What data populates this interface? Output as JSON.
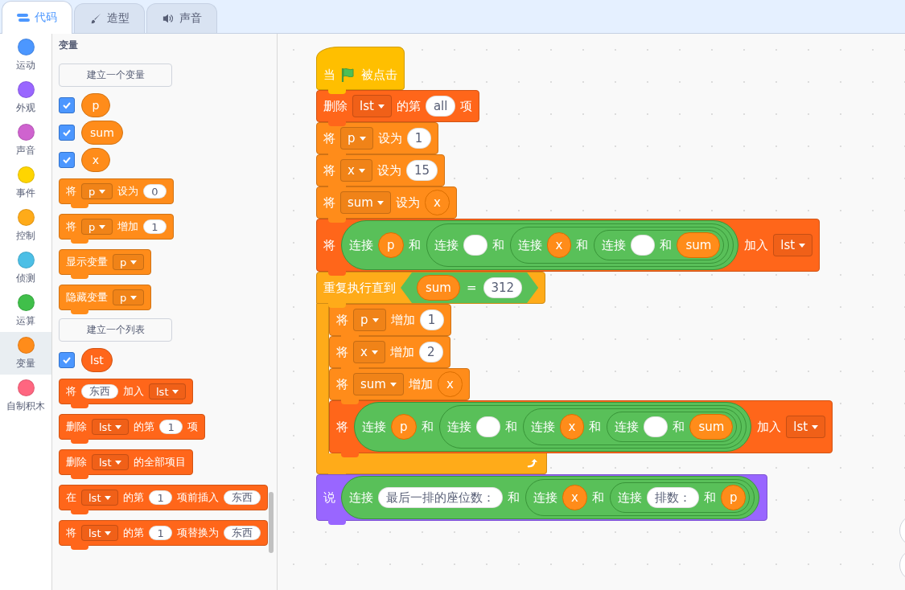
{
  "tabs": [
    {
      "label": "代码",
      "selected": true
    },
    {
      "label": "造型",
      "selected": false
    },
    {
      "label": "声音",
      "selected": false
    }
  ],
  "categories": [
    {
      "label": "运动",
      "color": "#4c97ff",
      "selected": false
    },
    {
      "label": "外观",
      "color": "#9966ff",
      "selected": false
    },
    {
      "label": "声音",
      "color": "#cf63cf",
      "selected": false
    },
    {
      "label": "事件",
      "color": "#ffd500",
      "selected": false
    },
    {
      "label": "控制",
      "color": "#ffab19",
      "selected": false
    },
    {
      "label": "侦测",
      "color": "#4cbfe6",
      "selected": false
    },
    {
      "label": "运算",
      "color": "#40bf4a",
      "selected": false
    },
    {
      "label": "变量",
      "color": "#ff8c1a",
      "selected": true
    },
    {
      "label": "自制积木",
      "color": "#ff6680",
      "selected": false
    }
  ],
  "palette": [
    {
      "kind": "heading",
      "text": "变量"
    },
    {
      "kind": "button",
      "text": "建立一个变量"
    },
    {
      "kind": "variable",
      "name": "p",
      "checked": true,
      "color": "#ff8c1a"
    },
    {
      "kind": "variable",
      "name": "sum",
      "checked": true,
      "color": "#ff8c1a"
    },
    {
      "kind": "variable",
      "name": "x",
      "checked": true,
      "color": "#ff8c1a"
    },
    {
      "kind": "block",
      "color": "#ff8c1a",
      "parts": [
        {
          "kind": "label",
          "text": "将"
        },
        {
          "kind": "dropdown",
          "text": "p"
        },
        {
          "kind": "label",
          "text": "设为"
        },
        {
          "kind": "input",
          "text": "0"
        }
      ]
    },
    {
      "kind": "block",
      "color": "#ff8c1a",
      "parts": [
        {
          "kind": "label",
          "text": "将"
        },
        {
          "kind": "dropdown",
          "text": "p"
        },
        {
          "kind": "label",
          "text": "增加"
        },
        {
          "kind": "input",
          "text": "1"
        }
      ]
    },
    {
      "kind": "block",
      "color": "#ff8c1a",
      "parts": [
        {
          "kind": "label",
          "text": "显示变量"
        },
        {
          "kind": "dropdown",
          "text": "p"
        }
      ]
    },
    {
      "kind": "block",
      "color": "#ff8c1a",
      "parts": [
        {
          "kind": "label",
          "text": "隐藏变量"
        },
        {
          "kind": "dropdown",
          "text": "p"
        }
      ]
    },
    {
      "kind": "button",
      "text": "建立一个列表"
    },
    {
      "kind": "variable",
      "name": "lst",
      "checked": true,
      "color": "#ff661a"
    },
    {
      "kind": "block",
      "color": "#ff661a",
      "parts": [
        {
          "kind": "label",
          "text": "将"
        },
        {
          "kind": "input",
          "text": "东西"
        },
        {
          "kind": "label",
          "text": "加入"
        },
        {
          "kind": "dropdown",
          "text": "lst"
        }
      ]
    },
    {
      "kind": "block",
      "color": "#ff661a",
      "parts": [
        {
          "kind": "label",
          "text": "删除"
        },
        {
          "kind": "dropdown",
          "text": "lst"
        },
        {
          "kind": "label",
          "text": "的第"
        },
        {
          "kind": "input",
          "text": "1"
        },
        {
          "kind": "label",
          "text": "项"
        }
      ]
    },
    {
      "kind": "block",
      "color": "#ff661a",
      "parts": [
        {
          "kind": "label",
          "text": "删除"
        },
        {
          "kind": "dropdown",
          "text": "lst"
        },
        {
          "kind": "label",
          "text": "的全部项目"
        }
      ]
    },
    {
      "kind": "block",
      "color": "#ff661a",
      "parts": [
        {
          "kind": "label",
          "text": "在"
        },
        {
          "kind": "dropdown",
          "text": "lst"
        },
        {
          "kind": "label",
          "text": "的第"
        },
        {
          "kind": "input",
          "text": "1"
        },
        {
          "kind": "label",
          "text": "项前插入"
        },
        {
          "kind": "input",
          "text": "东西"
        }
      ]
    },
    {
      "kind": "block",
      "color": "#ff661a",
      "parts": [
        {
          "kind": "label",
          "text": "将"
        },
        {
          "kind": "dropdown",
          "text": "lst"
        },
        {
          "kind": "label",
          "text": "的第"
        },
        {
          "kind": "input",
          "text": "1"
        },
        {
          "kind": "label",
          "text": "项替换为"
        },
        {
          "kind": "input",
          "text": "东西"
        }
      ]
    }
  ],
  "script": [
    {
      "kind": "hat",
      "color": "#ffbf00",
      "parts": [
        {
          "kind": "label",
          "text": "当"
        },
        {
          "kind": "flag"
        },
        {
          "kind": "label",
          "text": "被点击"
        }
      ]
    },
    {
      "kind": "stack",
      "color": "#ff661a",
      "parts": [
        {
          "kind": "label",
          "text": "删除"
        },
        {
          "kind": "dropdown",
          "text": "lst"
        },
        {
          "kind": "label",
          "text": "的第"
        },
        {
          "kind": "input",
          "text": "all"
        },
        {
          "kind": "label",
          "text": "项"
        }
      ]
    },
    {
      "kind": "stack",
      "color": "#ff8c1a",
      "parts": [
        {
          "kind": "label",
          "text": "将"
        },
        {
          "kind": "dropdown",
          "text": "p"
        },
        {
          "kind": "label",
          "text": "设为"
        },
        {
          "kind": "input",
          "text": "1"
        }
      ]
    },
    {
      "kind": "stack",
      "color": "#ff8c1a",
      "parts": [
        {
          "kind": "label",
          "text": "将"
        },
        {
          "kind": "dropdown",
          "text": "x"
        },
        {
          "kind": "label",
          "text": "设为"
        },
        {
          "kind": "input",
          "text": "15"
        }
      ]
    },
    {
      "kind": "stack",
      "color": "#ff8c1a",
      "parts": [
        {
          "kind": "label",
          "text": "将"
        },
        {
          "kind": "dropdown",
          "text": "sum"
        },
        {
          "kind": "label",
          "text": "设为"
        },
        {
          "kind": "variable",
          "text": "x"
        }
      ]
    },
    {
      "kind": "stack",
      "color": "#ff661a",
      "parts": [
        {
          "kind": "label",
          "text": "将"
        },
        {
          "kind": "join",
          "parts": [
            {
              "kind": "label",
              "text": "连接"
            },
            {
              "kind": "variable",
              "text": "p"
            },
            {
              "kind": "label",
              "text": "和"
            },
            {
              "kind": "join",
              "parts": [
                {
                  "kind": "label",
                  "text": "连接"
                },
                {
                  "kind": "input"
                },
                {
                  "kind": "label",
                  "text": "和"
                },
                {
                  "kind": "join",
                  "parts": [
                    {
                      "kind": "label",
                      "text": "连接"
                    },
                    {
                      "kind": "variable",
                      "text": "x"
                    },
                    {
                      "kind": "label",
                      "text": "和"
                    },
                    {
                      "kind": "join",
                      "parts": [
                        {
                          "kind": "label",
                          "text": "连接"
                        },
                        {
                          "kind": "input"
                        },
                        {
                          "kind": "label",
                          "text": "和"
                        },
                        {
                          "kind": "variable",
                          "text": "sum"
                        }
                      ]
                    }
                  ]
                }
              ]
            }
          ]
        },
        {
          "kind": "label",
          "text": "加入"
        },
        {
          "kind": "dropdown",
          "text": "lst"
        }
      ]
    },
    {
      "kind": "c",
      "color": "#ffab19",
      "parts": [
        {
          "kind": "label",
          "text": "重复执行直到"
        },
        {
          "kind": "compare",
          "parts": [
            {
              "kind": "variable",
              "text": "sum"
            },
            {
              "kind": "label",
              "text": "="
            },
            {
              "kind": "input",
              "text": "312"
            }
          ]
        }
      ],
      "children": [
        {
          "kind": "stack",
          "color": "#ff8c1a",
          "parts": [
            {
              "kind": "label",
              "text": "将"
            },
            {
              "kind": "dropdown",
              "text": "p"
            },
            {
              "kind": "label",
              "text": "增加"
            },
            {
              "kind": "input",
              "text": "1"
            }
          ]
        },
        {
          "kind": "stack",
          "color": "#ff8c1a",
          "parts": [
            {
              "kind": "label",
              "text": "将"
            },
            {
              "kind": "dropdown",
              "text": "x"
            },
            {
              "kind": "label",
              "text": "增加"
            },
            {
              "kind": "input",
              "text": "2"
            }
          ]
        },
        {
          "kind": "stack",
          "color": "#ff8c1a",
          "parts": [
            {
              "kind": "label",
              "text": "将"
            },
            {
              "kind": "dropdown",
              "text": "sum"
            },
            {
              "kind": "label",
              "text": "增加"
            },
            {
              "kind": "variable",
              "text": "x"
            }
          ]
        },
        {
          "kind": "stack",
          "color": "#ff661a",
          "parts": [
            {
              "kind": "label",
              "text": "将"
            },
            {
              "kind": "join",
              "parts": [
                {
                  "kind": "label",
                  "text": "连接"
                },
                {
                  "kind": "variable",
                  "text": "p"
                },
                {
                  "kind": "label",
                  "text": "和"
                },
                {
                  "kind": "join",
                  "parts": [
                    {
                      "kind": "label",
                      "text": "连接"
                    },
                    {
                      "kind": "input"
                    },
                    {
                      "kind": "label",
                      "text": "和"
                    },
                    {
                      "kind": "join",
                      "parts": [
                        {
                          "kind": "label",
                          "text": "连接"
                        },
                        {
                          "kind": "variable",
                          "text": "x"
                        },
                        {
                          "kind": "label",
                          "text": "和"
                        },
                        {
                          "kind": "join",
                          "parts": [
                            {
                              "kind": "label",
                              "text": "连接"
                            },
                            {
                              "kind": "input"
                            },
                            {
                              "kind": "label",
                              "text": "和"
                            },
                            {
                              "kind": "variable",
                              "text": "sum"
                            }
                          ]
                        }
                      ]
                    }
                  ]
                }
              ]
            },
            {
              "kind": "label",
              "text": "加入"
            },
            {
              "kind": "dropdown",
              "text": "lst"
            }
          ]
        }
      ]
    },
    {
      "kind": "stack",
      "color": "#9966ff",
      "parts": [
        {
          "kind": "label",
          "text": "说"
        },
        {
          "kind": "join",
          "parts": [
            {
              "kind": "label",
              "text": "连接"
            },
            {
              "kind": "input",
              "text": "最后一排的座位数："
            },
            {
              "kind": "label",
              "text": "和"
            },
            {
              "kind": "join",
              "parts": [
                {
                  "kind": "label",
                  "text": "连接"
                },
                {
                  "kind": "variable",
                  "text": "x"
                },
                {
                  "kind": "label",
                  "text": "和"
                },
                {
                  "kind": "join",
                  "parts": [
                    {
                      "kind": "label",
                      "text": "连接"
                    },
                    {
                      "kind": "input",
                      "text": "排数："
                    },
                    {
                      "kind": "label",
                      "text": "和"
                    },
                    {
                      "kind": "variable",
                      "text": "p"
                    }
                  ]
                }
              ]
            }
          ]
        }
      ]
    }
  ]
}
